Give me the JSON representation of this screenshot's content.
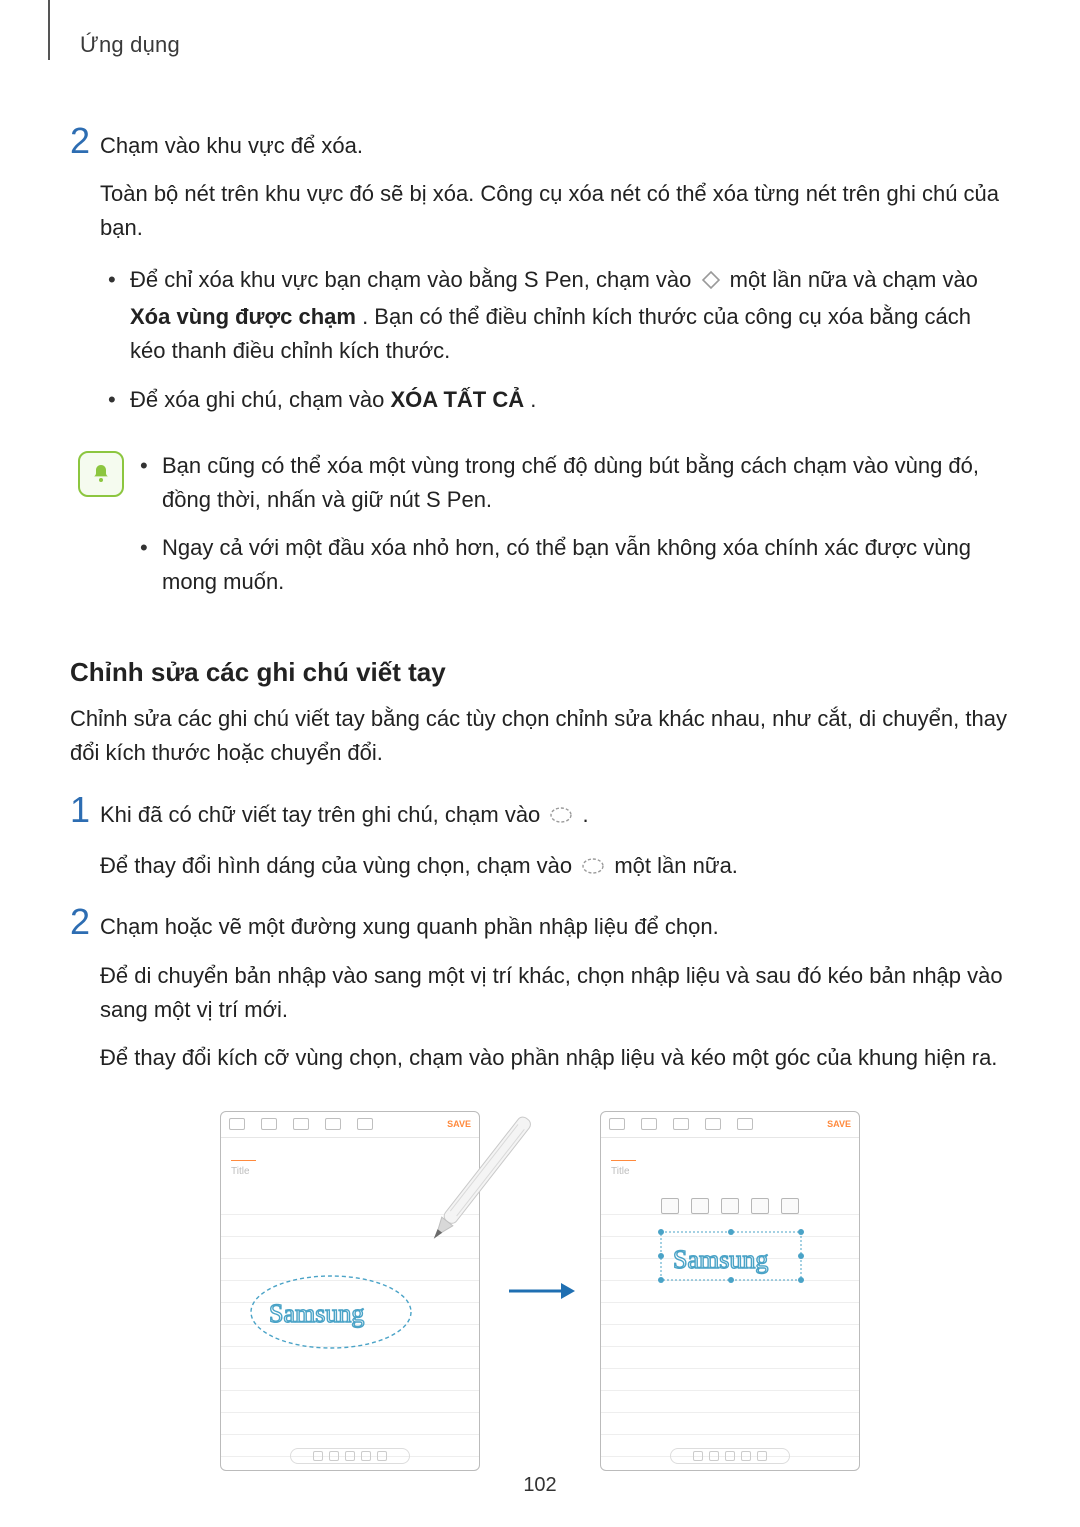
{
  "header": {
    "title": "Ứng dụng"
  },
  "step2": {
    "title": "Chạm vào khu vực để xóa.",
    "para": "Toàn bộ nét trên khu vực đó sẽ bị xóa. Công cụ xóa nét có thể xóa từng nét trên ghi chú của bạn.",
    "bullet1_a": "Để chỉ xóa khu vực bạn chạm vào bằng S Pen, chạm vào ",
    "bullet1_b": " một lần nữa và chạm vào ",
    "bullet1_bold": "Xóa vùng được chạm",
    "bullet1_c": ". Bạn có thể điều chỉnh kích thước của công cụ xóa bằng cách kéo thanh điều chỉnh kích thước.",
    "bullet2_a": "Để xóa ghi chú, chạm vào ",
    "bullet2_bold": "XÓA TẤT CẢ",
    "bullet2_b": "."
  },
  "note": {
    "b1": "Bạn cũng có thể xóa một vùng trong chế độ dùng bút bằng cách chạm vào vùng đó, đồng thời, nhấn và giữ nút S Pen.",
    "b2": "Ngay cả với một đầu xóa nhỏ hơn, có thể bạn vẫn không xóa chính xác được vùng mong muốn."
  },
  "section": {
    "heading": "Chỉnh sửa các ghi chú viết tay",
    "intro": "Chỉnh sửa các ghi chú viết tay bằng các tùy chọn chỉnh sửa khác nhau, như cắt, di chuyển, thay đổi kích thước hoặc chuyển đổi."
  },
  "s1": {
    "line1_a": "Khi đã có chữ viết tay trên ghi chú, chạm vào ",
    "line1_b": ".",
    "line2_a": "Để thay đổi hình dáng của vùng chọn, chạm vào ",
    "line2_b": " một lần nữa."
  },
  "s2": {
    "line1": "Chạm hoặc vẽ một đường xung quanh phần nhập liệu để chọn.",
    "line2": "Để di chuyển bản nhập vào sang một vị trí khác, chọn nhập liệu và sau đó kéo bản nhập vào sang một vị trí mới.",
    "line3": "Để thay đổi kích cỡ vùng chọn, chạm vào phần nhập liệu và kéo một góc của khung hiện ra."
  },
  "illus": {
    "save": "SAVE",
    "title_placeholder": "Title",
    "handwriting": "Samsung"
  },
  "pageNumber": "102"
}
